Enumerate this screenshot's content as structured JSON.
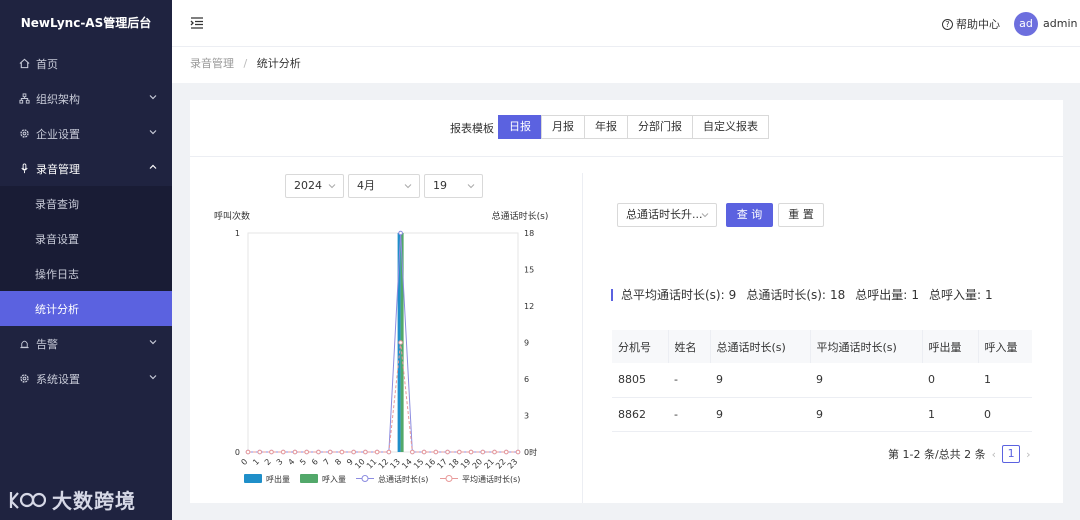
{
  "app": {
    "title": "NewLync-AS管理后台"
  },
  "sidebar": {
    "items": [
      {
        "label": "首页",
        "icon": "home-icon"
      },
      {
        "label": "组织架构",
        "icon": "org-icon"
      },
      {
        "label": "企业设置",
        "icon": "gear-icon"
      },
      {
        "label": "录音管理",
        "icon": "mic-icon"
      },
      {
        "label": "录音查询"
      },
      {
        "label": "录音设置"
      },
      {
        "label": "操作日志"
      },
      {
        "label": "统计分析"
      },
      {
        "label": "告警",
        "icon": "alarm-icon"
      },
      {
        "label": "系统设置",
        "icon": "gear-icon"
      }
    ]
  },
  "watermark": {
    "text": "大数跨境"
  },
  "header": {
    "help": "帮助中心",
    "avatar": "ad",
    "user": "admin"
  },
  "breadcrumb": {
    "parent": "录音管理",
    "separator": "/",
    "current": "统计分析"
  },
  "template": {
    "label": "报表模板",
    "tabs": [
      "日报",
      "月报",
      "年报",
      "分部门报",
      "自定义报表"
    ],
    "active": "日报"
  },
  "filters": {
    "year": "2024",
    "month": "4月",
    "day": "19"
  },
  "query": {
    "sort_select": "总通话时长升...",
    "search_btn": "查 询",
    "reset_btn": "重 置"
  },
  "summary": {
    "avg_label": "总平均通话时长(s):",
    "avg_value": "9",
    "total_label": "总通话时长(s):",
    "total_value": "18",
    "out_label": "总呼出量:",
    "out_value": "1",
    "in_label": "总呼入量:",
    "in_value": "1"
  },
  "table": {
    "headers": [
      "分机号",
      "姓名",
      "总通话时长(s)",
      "平均通话时长(s)",
      "呼出量",
      "呼入量"
    ],
    "rows": [
      [
        "8805",
        "-",
        "9",
        "9",
        "0",
        "1"
      ],
      [
        "8862",
        "-",
        "9",
        "9",
        "1",
        "0"
      ]
    ]
  },
  "pager": {
    "info": "第 1-2 条/总共 2 条",
    "page": "1",
    "prev": "‹",
    "next": "›"
  },
  "colors": {
    "accent": "#5b62e0",
    "out": "#1f8fc9",
    "in": "#52a86a",
    "total": "#8c8ce0",
    "avg": "#e89a9a"
  },
  "chart_data": {
    "type": "bar",
    "title": "",
    "ylabel_left": "呼叫次数",
    "ylabel_right": "总通话时长(s)",
    "x": [
      "0",
      "1",
      "2",
      "3",
      "4",
      "5",
      "6",
      "7",
      "8",
      "9",
      "10",
      "11",
      "12",
      "13",
      "14",
      "15",
      "16",
      "17",
      "18",
      "19",
      "20",
      "21",
      "22",
      "23"
    ],
    "ylim_left": [
      0,
      1
    ],
    "ylim_right": [
      0,
      18
    ],
    "left_ticks": [
      "0",
      "1"
    ],
    "right_ticks": [
      "0时",
      "3",
      "6",
      "9",
      "12",
      "15",
      "18"
    ],
    "series": [
      {
        "name": "呼出量",
        "type": "bar",
        "axis": "left",
        "values": [
          0,
          0,
          0,
          0,
          0,
          0,
          0,
          0,
          0,
          0,
          0,
          0,
          0,
          1,
          0,
          0,
          0,
          0,
          0,
          0,
          0,
          0,
          0,
          0
        ]
      },
      {
        "name": "呼入量",
        "type": "bar",
        "axis": "left",
        "values": [
          0,
          0,
          0,
          0,
          0,
          0,
          0,
          0,
          0,
          0,
          0,
          0,
          0,
          1,
          0,
          0,
          0,
          0,
          0,
          0,
          0,
          0,
          0,
          0
        ]
      },
      {
        "name": "总通话时长(s)",
        "type": "line",
        "axis": "right",
        "values": [
          0,
          0,
          0,
          0,
          0,
          0,
          0,
          0,
          0,
          0,
          0,
          0,
          0,
          18,
          0,
          0,
          0,
          0,
          0,
          0,
          0,
          0,
          0,
          0
        ]
      },
      {
        "name": "平均通话时长(s)",
        "type": "line",
        "axis": "right",
        "values": [
          0,
          0,
          0,
          0,
          0,
          0,
          0,
          0,
          0,
          0,
          0,
          0,
          0,
          9,
          0,
          0,
          0,
          0,
          0,
          0,
          0,
          0,
          0,
          0
        ]
      }
    ],
    "legend": "bottom"
  }
}
